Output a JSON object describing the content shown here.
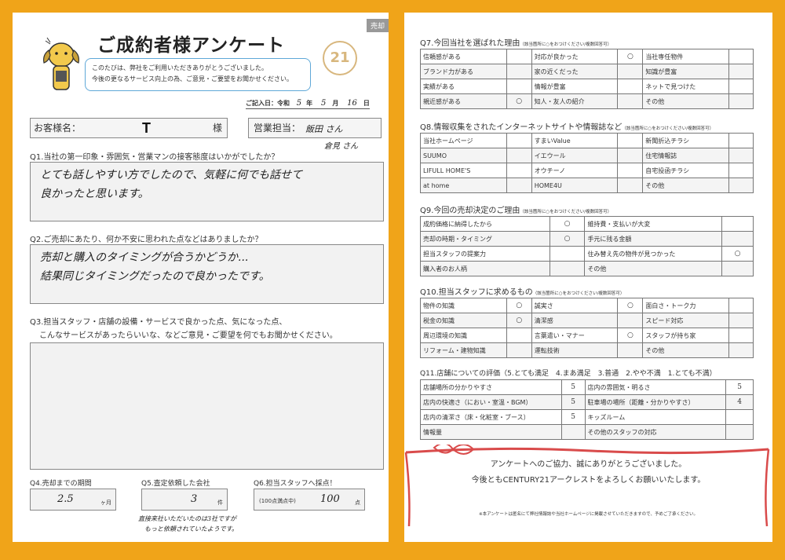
{
  "left": {
    "tag": "売却",
    "title": "ご成約者様アンケート",
    "greeting": [
      "このたびは、弊社をご利用いただきありがとうございました。",
      "今後の更なるサービス向上の為、ご意見・ご要望をお聞かせください。"
    ],
    "logo": "21",
    "date": {
      "label": "ご記入日：令和",
      "year": "5",
      "year_unit": "年",
      "month": "5",
      "month_unit": "月",
      "day": "16",
      "day_unit": "日"
    },
    "customer": {
      "label": "お客様名：",
      "value": "T",
      "suffix": "様"
    },
    "staff": {
      "label": "営業担当：",
      "value1": "飯田 さん",
      "value2": "倉見 さん"
    },
    "q1": {
      "question": "Q1.当社の第一印象・雰囲気・営業マンの接客態度はいかがでしたか？",
      "answer": [
        "とても話しやすい方でしたので、気軽に何でも話せて",
        "良かったと思います。"
      ]
    },
    "q2": {
      "question": "Q2.ご売却にあたり、何か不安に思われた点などはありましたか？",
      "answer": [
        "売却と購入のタイミングが合うかどうか...",
        "結果同じタイミングだったので良かったです。"
      ]
    },
    "q3": {
      "question": [
        "Q3.担当スタッフ・店舗の設備・サービスで良かった点、気になった点、",
        "こんなサービスがあったらいいな、などご意見・ご要望を何でもお聞かせください。"
      ],
      "answer": ""
    },
    "q4": {
      "question": "Q4.売却までの期間",
      "value": "2.5",
      "unit": "ヶ月"
    },
    "q5": {
      "question": "Q5.査定依頼した会社",
      "value": "3",
      "unit": "件",
      "note": [
        "直接来社いただいたのは3社ですが",
        "もっと依頼されていたようです。"
      ]
    },
    "q6": {
      "question": "Q6.担当スタッフへ採点！",
      "prefix": "(100点満点中)",
      "value": "100",
      "unit": "点"
    }
  },
  "right": {
    "q7": {
      "question": "Q7.今回当社を選ばれた理由",
      "hint": "（該当箇所に○をおつけください/複数回答可）",
      "rows": [
        [
          "信頼感がある",
          "",
          "対応が良かった",
          "○",
          "当社専任物件",
          ""
        ],
        [
          "ブランド力がある",
          "",
          "家の近くだった",
          "",
          "知識が豊富",
          ""
        ],
        [
          "実績がある",
          "",
          "情報が豊富",
          "",
          "ネットで見つけた",
          ""
        ],
        [
          "親近感がある",
          "○",
          "知人・友人の紹介",
          "",
          "その他",
          ""
        ]
      ]
    },
    "q8": {
      "question": "Q8.情報収集をされたインターネットサイトや情報誌など",
      "hint": "（該当箇所に○をおつけください/複数回答可）",
      "rows": [
        [
          "当社ホームページ",
          "",
          "すまいValue",
          "",
          "新聞折込チラシ",
          ""
        ],
        [
          "SUUMO",
          "",
          "イエウール",
          "",
          "住宅情報誌",
          ""
        ],
        [
          "LIFULL HOME'S",
          "",
          "オウチーノ",
          "",
          "自宅投函チラシ",
          ""
        ],
        [
          "at home",
          "",
          "HOME4U",
          "",
          "その他",
          ""
        ]
      ]
    },
    "q9": {
      "question": "Q9.今回の売却決定のご理由",
      "hint": "（該当箇所に○をおつけください/複数回答可）",
      "rows": [
        [
          "成約価格に納得したから",
          "○",
          "維持費・支払いが大変",
          ""
        ],
        [
          "売却の時期・タイミング",
          "○",
          "手元に残る金額",
          ""
        ],
        [
          "担当スタッフの提案力",
          "",
          "住み替え先の物件が見つかった",
          "○"
        ],
        [
          "購入者のお人柄",
          "",
          "その他",
          ""
        ]
      ]
    },
    "q10": {
      "question": "Q10.担当スタッフに求めるもの",
      "hint": "（該当箇所に○をおつけください/複数回答可）",
      "rows": [
        [
          "物件の知識",
          "○",
          "誠実さ",
          "○",
          "面白さ・トーク力",
          ""
        ],
        [
          "税金の知識",
          "○",
          "清潔感",
          "",
          "スピード対応",
          ""
        ],
        [
          "周辺環境の知識",
          "",
          "言葉遣い・マナー",
          "○",
          "スタッフが持ち家",
          ""
        ],
        [
          "リフォーム・建物知識",
          "",
          "運転技術",
          "",
          "その他",
          ""
        ]
      ]
    },
    "q11": {
      "question": "Q11.店舗についての評価（5.とても満足　4.まあ満足　3.普通　2.やや不満　1.とても不満）",
      "rows": [
        [
          "店舗場所の分かりやすさ",
          "5",
          "店内の雰囲気・明るさ",
          "5"
        ],
        [
          "店内の快適さ（におい・室温・BGM）",
          "5",
          "駐車場の場所（距離・分かりやすさ）",
          "4"
        ],
        [
          "店内の清潔さ（床・化粧室・ブース）",
          "5",
          "キッズルーム",
          ""
        ],
        [
          "情報量",
          "",
          "その他のスタッフの対応",
          ""
        ]
      ]
    },
    "thanks": [
      "アンケートへのご協力、誠にありがとうございました。",
      "今後ともCENTURY21アークレストをよろしくお願いいたします。"
    ],
    "fine": "※本アンケートは匿名にて弊社情報誌や当社ホームページに掲載させていただきますので、予めご了承ください。"
  }
}
